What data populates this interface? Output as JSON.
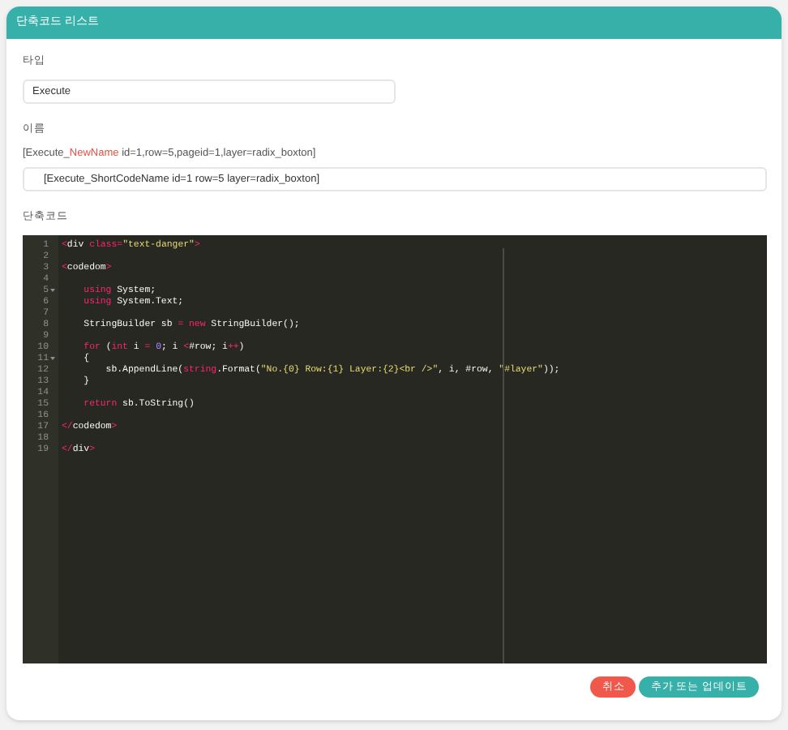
{
  "panel": {
    "title": "단축코드 리스트"
  },
  "type_field": {
    "label": "타입",
    "value": "Execute"
  },
  "name_field": {
    "label": "이름",
    "hint": [
      {
        "text": "[Execute_",
        "highlight": false
      },
      {
        "text": "NewName",
        "highlight": true
      },
      {
        "text": " id=1,row=5,pageid=1,layer=radix_boxton]",
        "highlight": false
      }
    ],
    "value": "[Execute_ShortCodeName id=1 row=5 layer=radix_boxton]"
  },
  "code_editor": {
    "label": "단축코드",
    "lines": [
      {
        "number": "1",
        "fold": false,
        "tokens": [
          {
            "kind": "punct",
            "text": "<"
          },
          {
            "kind": "plain",
            "text": "div "
          },
          {
            "kind": "keyword",
            "text": "class"
          },
          {
            "kind": "punct",
            "text": "="
          },
          {
            "kind": "string",
            "text": "\"text-danger\""
          },
          {
            "kind": "punct",
            "text": ">"
          }
        ]
      },
      {
        "number": "2",
        "fold": false
      },
      {
        "number": "3",
        "fold": false,
        "tokens": [
          {
            "kind": "punct",
            "text": "<"
          },
          {
            "kind": "plain",
            "text": "codedom"
          },
          {
            "kind": "punct",
            "text": ">"
          }
        ]
      },
      {
        "number": "4",
        "fold": false
      },
      {
        "number": "5",
        "fold": true,
        "tokens": [
          {
            "kind": "keyword",
            "text": "    using"
          },
          {
            "kind": "plain",
            "text": " System;"
          }
        ]
      },
      {
        "number": "6",
        "fold": false,
        "tokens": [
          {
            "kind": "keyword",
            "text": "    using"
          },
          {
            "kind": "plain",
            "text": " System.Text;"
          }
        ]
      },
      {
        "number": "7",
        "fold": false
      },
      {
        "number": "8",
        "fold": false,
        "tokens": [
          {
            "kind": "plain",
            "text": "    StringBuilder sb "
          },
          {
            "kind": "keyword",
            "text": "="
          },
          {
            "kind": "keyword",
            "text": " new"
          },
          {
            "kind": "plain",
            "text": " StringBuilder();"
          }
        ]
      },
      {
        "number": "9",
        "fold": false
      },
      {
        "number": "10",
        "fold": false,
        "tokens": [
          {
            "kind": "keyword",
            "text": "    for"
          },
          {
            "kind": "plain",
            "text": " ("
          },
          {
            "kind": "keyword",
            "text": "int"
          },
          {
            "kind": "plain",
            "text": " i "
          },
          {
            "kind": "keyword",
            "text": "="
          },
          {
            "kind": "number",
            "text": " 0"
          },
          {
            "kind": "plain",
            "text": "; i "
          },
          {
            "kind": "keyword",
            "text": "<"
          },
          {
            "kind": "plain",
            "text": "#row; i"
          },
          {
            "kind": "keyword",
            "text": "++"
          },
          {
            "kind": "plain",
            "text": ")"
          }
        ]
      },
      {
        "number": "11",
        "fold": true,
        "tokens": [
          {
            "kind": "plain",
            "text": "    {"
          }
        ]
      },
      {
        "number": "12",
        "fold": false,
        "tokens": [
          {
            "kind": "plain",
            "text": "        sb.AppendLine("
          },
          {
            "kind": "keyword",
            "text": "string"
          },
          {
            "kind": "plain",
            "text": ".Format("
          },
          {
            "kind": "string",
            "text": "\"No.{0} Row:{1} Layer:{2}<br />\""
          },
          {
            "kind": "plain",
            "text": ", i, #row, "
          },
          {
            "kind": "string",
            "text": "\"#layer\""
          },
          {
            "kind": "plain",
            "text": "));"
          }
        ]
      },
      {
        "number": "13",
        "fold": false,
        "tokens": [
          {
            "kind": "plain",
            "text": "    }"
          }
        ]
      },
      {
        "number": "14",
        "fold": false
      },
      {
        "number": "15",
        "fold": false,
        "tokens": [
          {
            "kind": "keyword",
            "text": "    return"
          },
          {
            "kind": "plain",
            "text": " sb.ToString()"
          }
        ]
      },
      {
        "number": "16",
        "fold": false
      },
      {
        "number": "17",
        "fold": false,
        "tokens": [
          {
            "kind": "punct",
            "text": "</"
          },
          {
            "kind": "plain",
            "text": "codedom"
          },
          {
            "kind": "punct",
            "text": ">"
          }
        ]
      },
      {
        "number": "18",
        "fold": false
      },
      {
        "number": "19",
        "fold": false,
        "tokens": [
          {
            "kind": "punct",
            "text": "</"
          },
          {
            "kind": "plain",
            "text": "div"
          },
          {
            "kind": "punct",
            "text": ">"
          }
        ]
      }
    ]
  },
  "buttons": [
    {
      "kind": "cancel",
      "label": "취소"
    },
    {
      "kind": "primary",
      "label": "추가 또는 업데이트"
    }
  ]
}
